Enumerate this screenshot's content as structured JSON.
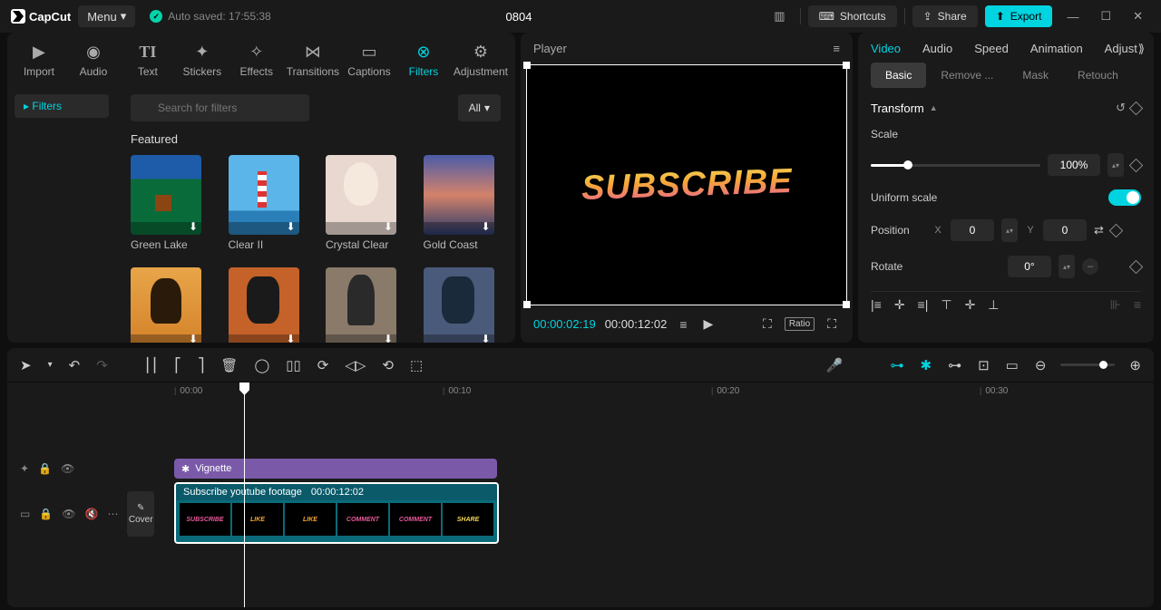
{
  "app": {
    "name": "CapCut",
    "menu": "Menu",
    "autosave": "Auto saved: 17:55:38",
    "title": "0804"
  },
  "topbar": {
    "shortcuts": "Shortcuts",
    "share": "Share",
    "export": "Export"
  },
  "mediaTabs": {
    "import": "Import",
    "audio": "Audio",
    "text": "Text",
    "stickers": "Stickers",
    "effects": "Effects",
    "transitions": "Transitions",
    "captions": "Captions",
    "filters": "Filters",
    "adjustment": "Adjustment"
  },
  "filters": {
    "category": "Filters",
    "searchPlaceholder": "Search for filters",
    "allBtn": "All",
    "section": "Featured",
    "items": [
      {
        "name": "Green Lake"
      },
      {
        "name": "Clear II"
      },
      {
        "name": "Crystal Clear"
      },
      {
        "name": "Gold Coast"
      },
      {
        "name": ""
      },
      {
        "name": ""
      },
      {
        "name": ""
      },
      {
        "name": ""
      }
    ]
  },
  "player": {
    "title": "Player",
    "overlayText": "SUBSCRIBE",
    "current": "00:00:02:19",
    "total": "00:00:12:02",
    "ratio": "Ratio"
  },
  "inspector": {
    "tabs": {
      "video": "Video",
      "audio": "Audio",
      "speed": "Speed",
      "animation": "Animation",
      "adjust": "Adjust"
    },
    "subtabs": {
      "basic": "Basic",
      "remove": "Remove ...",
      "mask": "Mask",
      "retouch": "Retouch"
    },
    "transform": "Transform",
    "scale": "Scale",
    "scaleValue": "100%",
    "uniform": "Uniform scale",
    "position": "Position",
    "posX": "0",
    "posY": "0",
    "rotate": "Rotate",
    "rotateValue": "0°"
  },
  "timeline": {
    "ticks": [
      "00:00",
      "00:10",
      "00:20",
      "00:30"
    ],
    "filterClip": "Vignette",
    "videoClip": {
      "name": "Subscribe youtube footage",
      "duration": "00:00:12:02"
    },
    "frames": [
      "SUBSCRIBE",
      "LIKE",
      "LIKE",
      "COMMENT",
      "COMMENT",
      "SHARE"
    ],
    "cover": "Cover"
  }
}
